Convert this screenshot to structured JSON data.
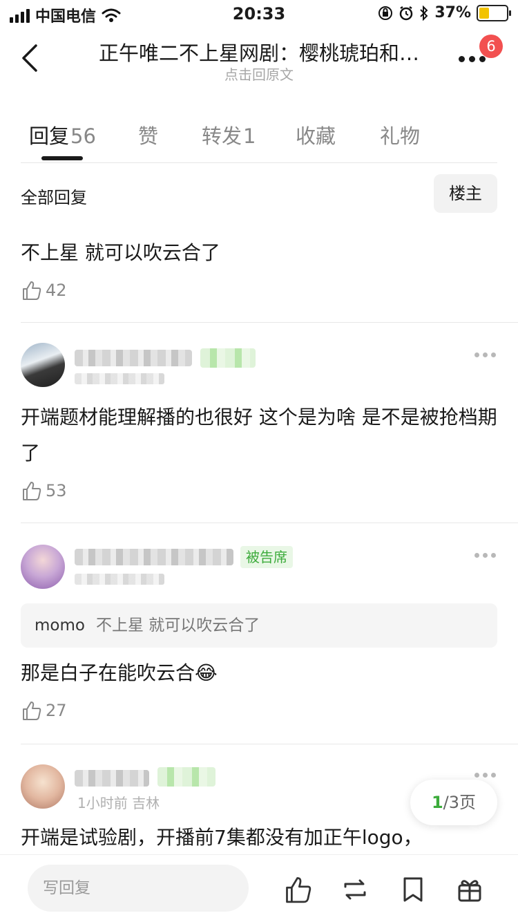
{
  "status_bar": {
    "carrier": "中国电信",
    "time": "20:33",
    "battery": "37%",
    "battery_level": 0.37
  },
  "header": {
    "title": "正午唯二不上星网剧：樱桃琥珀和…",
    "subtitle": "点击回原文",
    "badge_count": "6"
  },
  "tabs": [
    {
      "label": "回复",
      "count": "56"
    },
    {
      "label": "赞",
      "count": ""
    },
    {
      "label": "转发",
      "count": "1"
    },
    {
      "label": "收藏",
      "count": ""
    },
    {
      "label": "礼物",
      "count": ""
    }
  ],
  "filter": {
    "all_label": "全部回复",
    "op_label": "楼主"
  },
  "comments": [
    {
      "text": "不上星 就可以吹云合了",
      "likes": "42"
    },
    {
      "text": "开端题材能理解播的也很好 这个是为啥 是不是被抢档期了",
      "likes": "53"
    },
    {
      "tag": "被告席",
      "quote_name": "momo",
      "quote_text": "不上星 就可以吹云合了",
      "text": "那是白子在能吹云合😂",
      "likes": "27"
    },
    {
      "meta": "1小时前 吉林",
      "text": "开端是试验剧，开播前7集都没有加正午logo，"
    }
  ],
  "pager": {
    "current": "1",
    "total": "/3页"
  },
  "bottom": {
    "reply_placeholder": "写回复"
  },
  "colors": {
    "accent_green": "#3cab3b",
    "badge_red": "#f25050"
  }
}
